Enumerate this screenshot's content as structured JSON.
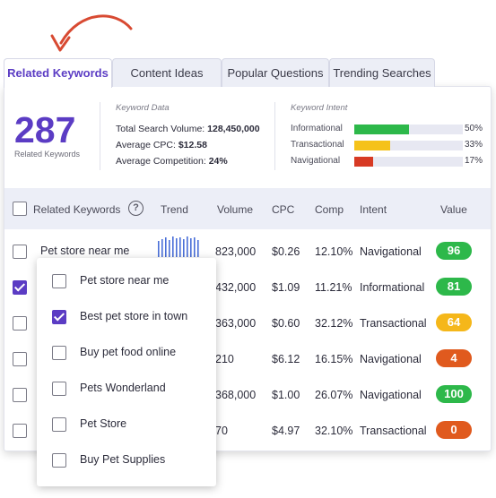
{
  "tabs": [
    {
      "label": "Related Keywords",
      "active": true
    },
    {
      "label": "Content Ideas",
      "active": false
    },
    {
      "label": "Popular Questions",
      "active": false
    },
    {
      "label": "Trending Searches",
      "active": false
    }
  ],
  "summary": {
    "count": "287",
    "count_label": "Related Keywords",
    "keyword_data_title": "Keyword Data",
    "stats": [
      {
        "label": "Total Search Volume: ",
        "value": "128,450,000"
      },
      {
        "label": "Average CPC: ",
        "value": "$12.58"
      },
      {
        "label": "Average Competition: ",
        "value": "24%"
      }
    ],
    "intent_title": "Keyword Intent",
    "intents": [
      {
        "name": "Informational",
        "pct": "50%",
        "fraction": 0.5,
        "color": "#2db84a"
      },
      {
        "name": "Transactional",
        "pct": "33%",
        "fraction": 0.33,
        "color": "#f5c21a"
      },
      {
        "name": "Navigational",
        "pct": "17%",
        "fraction": 0.17,
        "color": "#d73a24"
      }
    ]
  },
  "table": {
    "headers": {
      "keyword": "Related Keywords",
      "trend": "Trend",
      "volume": "Volume",
      "cpc": "CPC",
      "comp": "Comp",
      "intent": "Intent",
      "value": "Value"
    },
    "rows": [
      {
        "keyword": "Pet store near me",
        "volume": "823,000",
        "cpc": "$0.26",
        "comp": "12.10%",
        "intent": "Navigational",
        "value": "96",
        "badge_color": "#2db84a",
        "checked": false
      },
      {
        "keyword": "",
        "volume": "432,000",
        "cpc": "$1.09",
        "comp": "11.21%",
        "intent": "Informational",
        "value": "81",
        "badge_color": "#2db84a",
        "checked": true
      },
      {
        "keyword": "",
        "volume": "363,000",
        "cpc": "$0.60",
        "comp": "32.12%",
        "intent": "Transactional",
        "value": "64",
        "badge_color": "#f5b71a",
        "checked": false
      },
      {
        "keyword": "",
        "volume": "210",
        "cpc": "$6.12",
        "comp": "16.15%",
        "intent": "Navigational",
        "value": "4",
        "badge_color": "#e05a1e",
        "checked": false
      },
      {
        "keyword": "",
        "volume": "368,000",
        "cpc": "$1.00",
        "comp": "26.07%",
        "intent": "Navigational",
        "value": "100",
        "badge_color": "#2db84a",
        "checked": false
      },
      {
        "keyword": "",
        "volume": "70",
        "cpc": "$4.97",
        "comp": "32.10%",
        "intent": "Transactional",
        "value": "0",
        "badge_color": "#e05a1e",
        "checked": false
      }
    ]
  },
  "dropdown": {
    "items": [
      {
        "label": "Pet store near me",
        "checked": false
      },
      {
        "label": "Best pet store in town",
        "checked": true
      },
      {
        "label": "Buy pet food online",
        "checked": false
      },
      {
        "label": "Pets Wonderland",
        "checked": false
      },
      {
        "label": "Pet Store",
        "checked": false
      },
      {
        "label": "Buy Pet Supplies",
        "checked": false
      }
    ]
  },
  "colors": {
    "accent": "#5b3cc4",
    "arrow": "#d84a32",
    "trend_bars": "#4a6fd8"
  }
}
